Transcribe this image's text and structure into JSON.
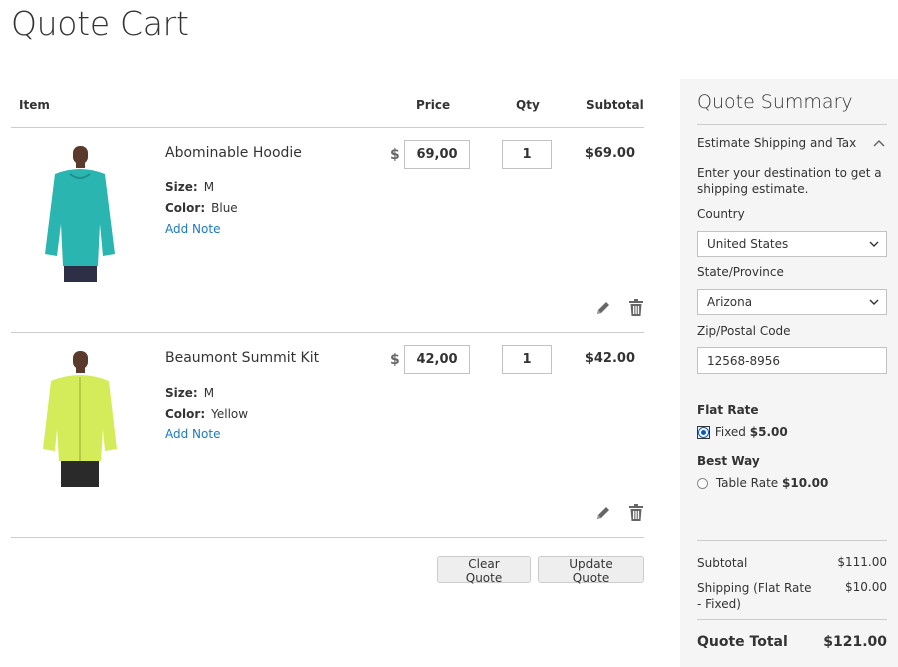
{
  "page": {
    "title": "Quote Cart"
  },
  "cart": {
    "columns": {
      "item": "Item",
      "price": "Price",
      "qty": "Qty",
      "subtotal": "Subtotal"
    },
    "currency_symbol": "$",
    "items": [
      {
        "name": "Abominable Hoodie",
        "size_label": "Size:",
        "size": "M",
        "color_label": "Color:",
        "color": "Blue",
        "add_note": "Add Note",
        "price": "69,00",
        "qty": "1",
        "subtotal": "$69.00",
        "product_color": "#2ab5b0"
      },
      {
        "name": "Beaumont Summit Kit",
        "size_label": "Size:",
        "size": "M",
        "color_label": "Color:",
        "color": "Yellow",
        "add_note": "Add Note",
        "price": "42,00",
        "qty": "1",
        "subtotal": "$42.00",
        "product_color": "#d4ec5a"
      }
    ],
    "actions": {
      "clear": "Clear Quote",
      "update": "Update Quote"
    }
  },
  "summary": {
    "title": "Quote Summary",
    "estimate": {
      "title": "Estimate Shipping and Tax",
      "text": "Enter your destination to get a shipping estimate.",
      "country_label": "Country",
      "country": "United States",
      "state_label": "State/Province",
      "state": "Arizona",
      "zip_label": "Zip/Postal Code",
      "zip": "12568-8956"
    },
    "methods": [
      {
        "title": "Flat Rate",
        "option": "Fixed",
        "price": "$5.00",
        "selected": true
      },
      {
        "title": "Best Way",
        "option": "Table Rate",
        "price": "$10.00",
        "selected": false
      }
    ],
    "totals": {
      "subtotal_label": "Subtotal",
      "subtotal": "$111.00",
      "shipping_label": "Shipping (Flat Rate - Fixed)",
      "shipping": "$10.00",
      "grand_label": "Quote Total",
      "grand": "$121.00"
    }
  },
  "colors": {
    "link": "#1979c3",
    "radio_selected": "#0a57c4",
    "summary_bg": "#f5f5f5",
    "divider": "#cccccc"
  }
}
